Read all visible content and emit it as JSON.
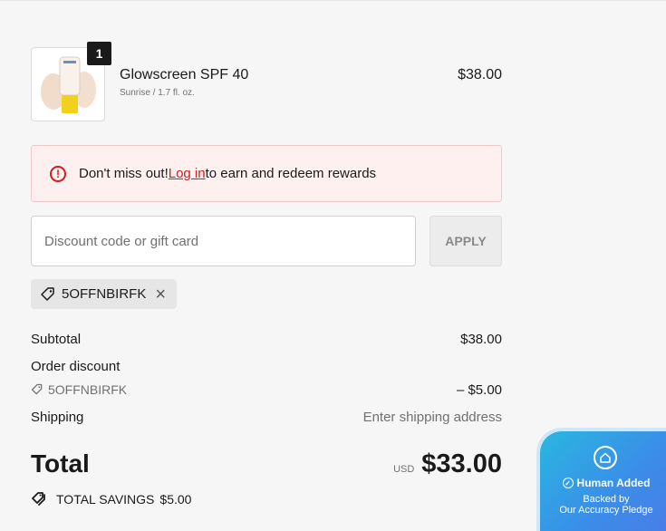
{
  "cart": {
    "quantity": "1",
    "product_name": "Glowscreen SPF 40",
    "product_variant": "Sunrise / 1.7 fl. oz.",
    "product_price": "$38.00"
  },
  "alert": {
    "prefix": "Don't miss out! ",
    "link": "Log in",
    "suffix": " to earn and redeem rewards",
    "icon": "info-icon"
  },
  "discount": {
    "placeholder": "Discount code or gift card",
    "value": "",
    "apply_label": "APPLY",
    "applied_code": "5OFFNBIRFK"
  },
  "summary": {
    "subtotal_label": "Subtotal",
    "subtotal_value": "$38.00",
    "discount_label": "Order discount",
    "discount_code": "5OFFNBIRFK",
    "discount_value": "– $5.00",
    "shipping_label": "Shipping",
    "shipping_value": "Enter shipping address",
    "total_label": "Total",
    "currency": "USD",
    "total_value": "$33.00",
    "savings_label": "TOTAL SAVINGS",
    "savings_value": "$5.00"
  },
  "pledge": {
    "headline": "Human Added",
    "line1": "Backed by",
    "line2": "Our Accuracy Pledge"
  },
  "colors": {
    "accent_red": "#d11e1e",
    "pledge_blue": "#3a8ee8"
  }
}
